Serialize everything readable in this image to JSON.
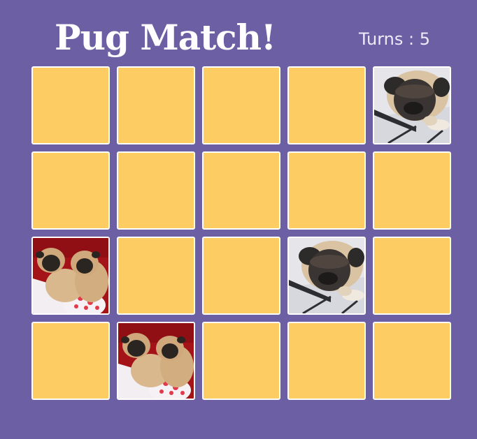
{
  "header": {
    "title": "Pug Match!",
    "turns_text": "Turns : 5"
  },
  "colors": {
    "background": "#6c5fa3",
    "card_back": "#fdcd63",
    "card_border": "#ffffff"
  },
  "board": {
    "rows": 4,
    "columns": 5,
    "cards": [
      {
        "state": "hidden"
      },
      {
        "state": "hidden"
      },
      {
        "state": "hidden"
      },
      {
        "state": "hidden"
      },
      {
        "state": "revealed",
        "image": "pug-on-chair"
      },
      {
        "state": "hidden"
      },
      {
        "state": "hidden"
      },
      {
        "state": "hidden"
      },
      {
        "state": "hidden"
      },
      {
        "state": "hidden"
      },
      {
        "state": "revealed",
        "image": "two-pugs-in-bed"
      },
      {
        "state": "hidden"
      },
      {
        "state": "hidden"
      },
      {
        "state": "revealed",
        "image": "pug-on-chair"
      },
      {
        "state": "hidden"
      },
      {
        "state": "hidden"
      },
      {
        "state": "revealed",
        "image": "two-pugs-in-bed"
      },
      {
        "state": "hidden"
      },
      {
        "state": "hidden"
      },
      {
        "state": "hidden"
      }
    ]
  }
}
